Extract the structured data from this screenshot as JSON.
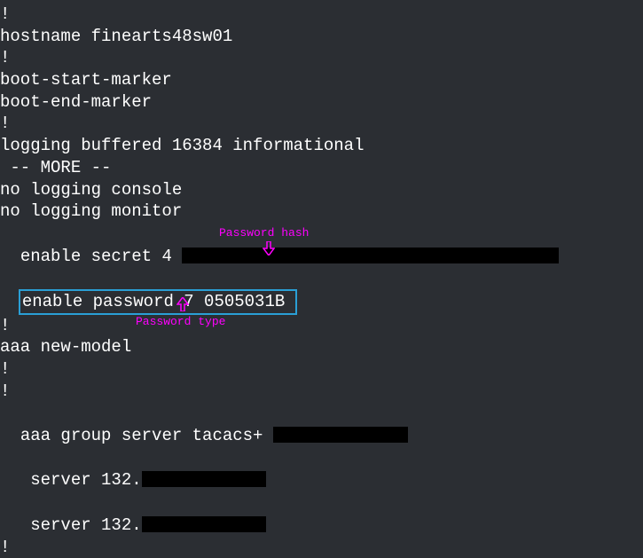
{
  "lines": {
    "l1": "!",
    "l2": "hostname finearts48sw01",
    "l3": "!",
    "l4": "boot-start-marker",
    "l5": "boot-end-marker",
    "l6": "!",
    "l7": "logging buffered 16384 informational",
    "l8": " -- MORE --",
    "l9": "no logging console",
    "l10": "no logging monitor",
    "l11_prefix": "enable secret 4 ",
    "l12_content": "enable password 7 0505031B ",
    "l13": "!",
    "l14": "aaa new-model",
    "l15": "!",
    "l16": "!",
    "l17_prefix": "aaa group server tacacs+ ",
    "l18_prefix": " server 132.",
    "l19_prefix": " server 132.",
    "l20": "!"
  },
  "annotations": {
    "password_hash": "Password hash",
    "password_type": "Password type"
  },
  "redacted_widths": {
    "hash": "425px",
    "tacacs": "152px",
    "server1": "140px",
    "server2": "140px"
  }
}
